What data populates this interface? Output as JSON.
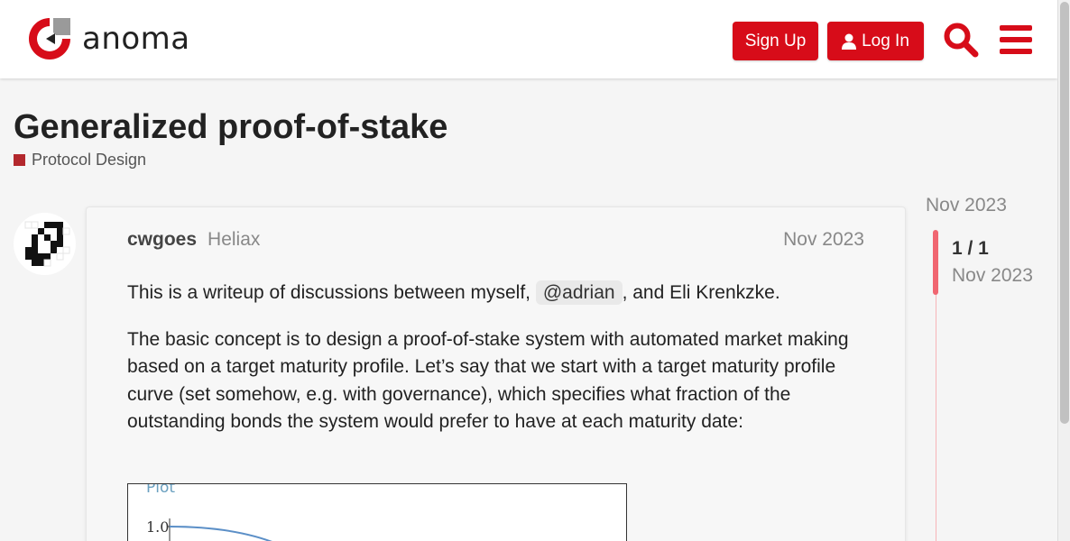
{
  "header": {
    "logo_text": "anoma",
    "signup_label": "Sign Up",
    "login_label": "Log In",
    "brand_color": "#d70c19"
  },
  "topic": {
    "title": "Generalized proof-of-stake",
    "category": "Protocol Design",
    "category_color": "#b3282d"
  },
  "post": {
    "username": "cwgoes",
    "user_title": "Heliax",
    "date": "Nov 2023",
    "para1_before": "This is a writeup of discussions between myself, ",
    "mention": "@adrian",
    "para1_after": ", and Eli Krenkzke.",
    "para2": "The basic concept is to design a proof-of-stake system with automated market making based on a target maturity profile. Let’s say that we start with a target maturity profile curve (set somehow, e.g. with governance), which specifies what fraction of the outstanding bonds the system would prefer to have at each maturity date:",
    "plot_title": "Plot",
    "plot_ytick": "1.0"
  },
  "timeline": {
    "top_date": "Nov 2023",
    "position": "1 / 1",
    "bottom_date": "Nov 2023"
  }
}
